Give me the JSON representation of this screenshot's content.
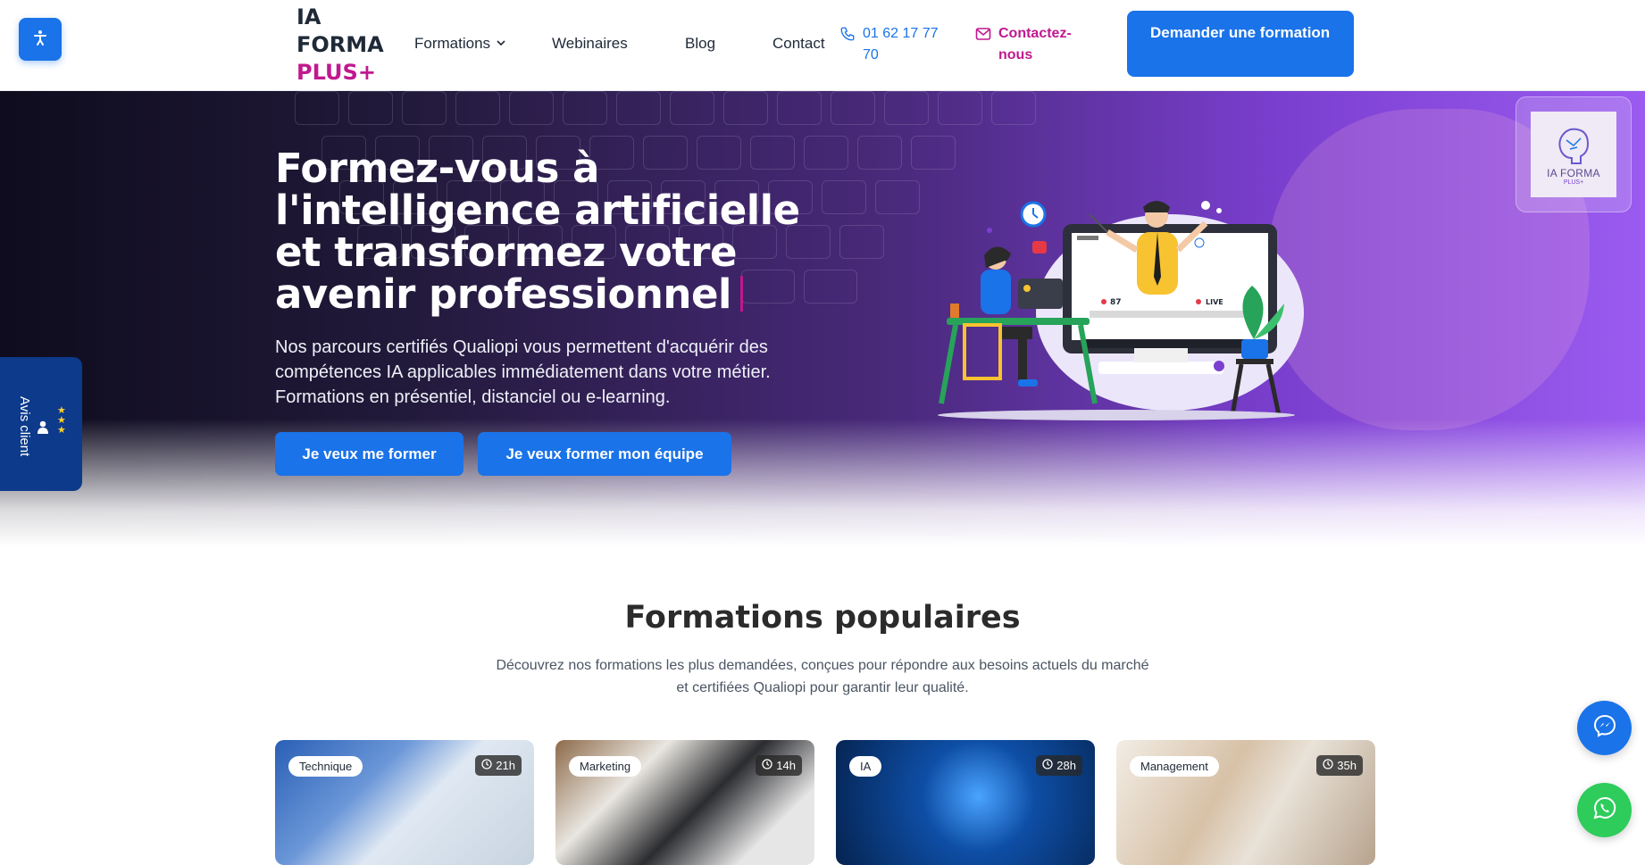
{
  "header": {
    "logo": {
      "line1": "IA",
      "line2": "FORMA",
      "line3": "PLUS",
      "line3_suffix": "+"
    },
    "nav": [
      {
        "label": "Formations"
      },
      {
        "label": "Webinaires"
      },
      {
        "label": "Blog"
      },
      {
        "label": "Contact"
      }
    ],
    "phone": "01 62 17 77 70",
    "email_label": "Contactez-nous",
    "cta": "Demander une formation"
  },
  "hero": {
    "title": "Formez-vous à l'intelligence artificielle et transformez votre avenir professionnel",
    "subtitle": "Nos parcours certifiés Qualiopi vous permettent d'acquérir des compétences IA applicables immédiatement dans votre métier. Formations en présentiel, distanciel ou e-learning.",
    "btn_primary": "Je veux me former",
    "btn_secondary": "Je veux former mon équipe",
    "badge": {
      "title": "IA FORMA",
      "sub": "PLUS+"
    },
    "illustration_labels": {
      "viewers": "87",
      "live": "LIVE"
    }
  },
  "reviews_tab": {
    "label": "Avis client",
    "stars": 3
  },
  "section": {
    "title": "Formations populaires",
    "subtitle": "Découvrez nos formations les plus demandées, conçues pour répondre aux besoins actuels du marché et certifiées Qualiopi pour garantir leur qualité."
  },
  "cards": [
    {
      "tag": "Technique",
      "duration": "21h"
    },
    {
      "tag": "Marketing",
      "duration": "14h"
    },
    {
      "tag": "IA",
      "duration": "28h"
    },
    {
      "tag": "Management",
      "duration": "35h"
    }
  ],
  "colors": {
    "primary": "#1a73e8",
    "accent": "#c0188f",
    "whatsapp": "#2dcc5b",
    "reviews": "#0d3a8a"
  },
  "icons": [
    "accessibility-icon",
    "chevron-down-icon",
    "phone-icon",
    "mail-icon",
    "clock-icon",
    "messenger-icon",
    "whatsapp-icon",
    "user-icon",
    "star-icon"
  ]
}
